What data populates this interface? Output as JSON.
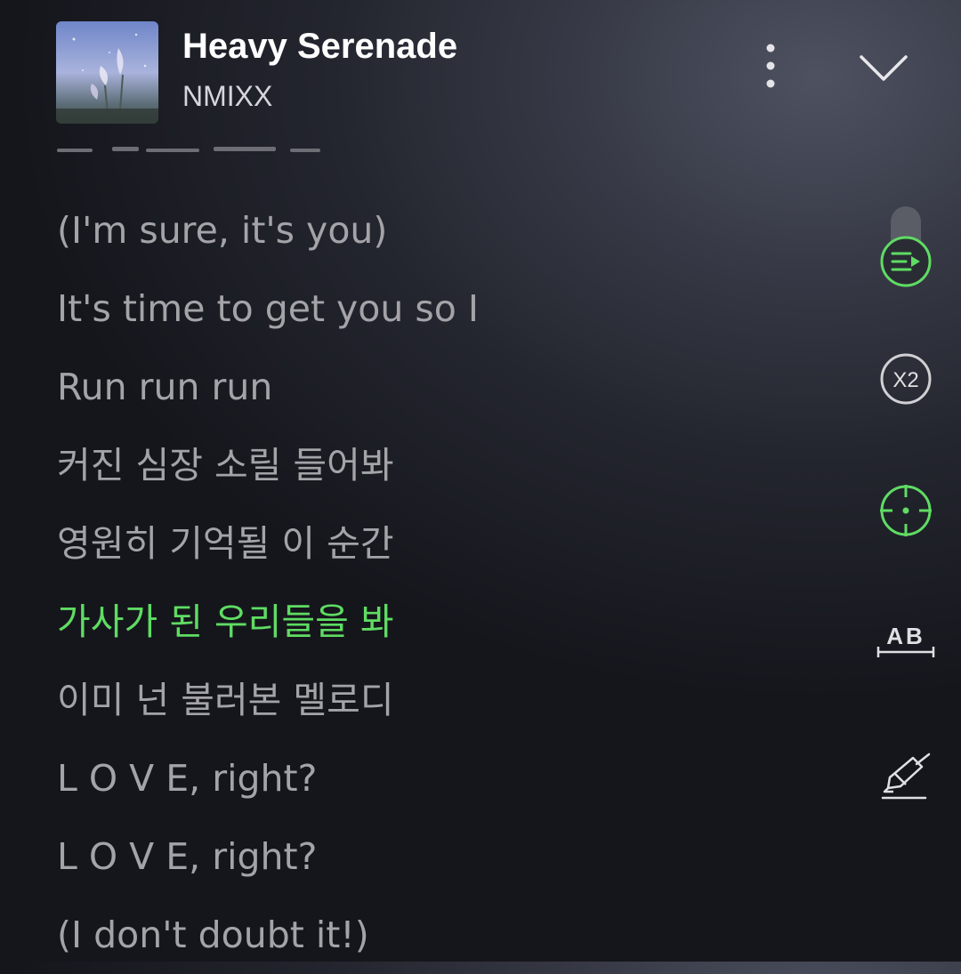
{
  "player": {
    "title": "Heavy Serenade",
    "artist": "NMIXX"
  },
  "lyrics": [
    {
      "text": "(I'm sure, it's you)",
      "active": false
    },
    {
      "text": "It's time to get you so I",
      "active": false
    },
    {
      "text": "Run run run",
      "active": false
    },
    {
      "text": "커진 심장 소릴 들어봐",
      "active": false
    },
    {
      "text": "영원히 기억될 이 순간",
      "active": false
    },
    {
      "text": "가사가 된 우리들을 봐",
      "active": true
    },
    {
      "text": "이미 넌 불러본 멜로디",
      "active": false
    },
    {
      "text": "L O V E, right?",
      "active": false
    },
    {
      "text": "L O V E, right?",
      "active": false
    },
    {
      "text": "(I don't doubt it!)",
      "active": false
    }
  ],
  "side_controls": {
    "speed_label": "X2",
    "ab_label": "AB"
  },
  "colors": {
    "accent": "#5fdc63",
    "lyric": "#a3a3a8",
    "title": "#ffffff",
    "icon": "#d0d0d4"
  },
  "icons": {
    "more": "more-vertical-icon",
    "collapse": "chevron-down-icon",
    "playlist": "playlist-play-icon",
    "speed": "speed-x2-icon",
    "locate": "crosshair-icon",
    "ab_repeat": "ab-repeat-icon",
    "highlight": "highlighter-icon"
  }
}
